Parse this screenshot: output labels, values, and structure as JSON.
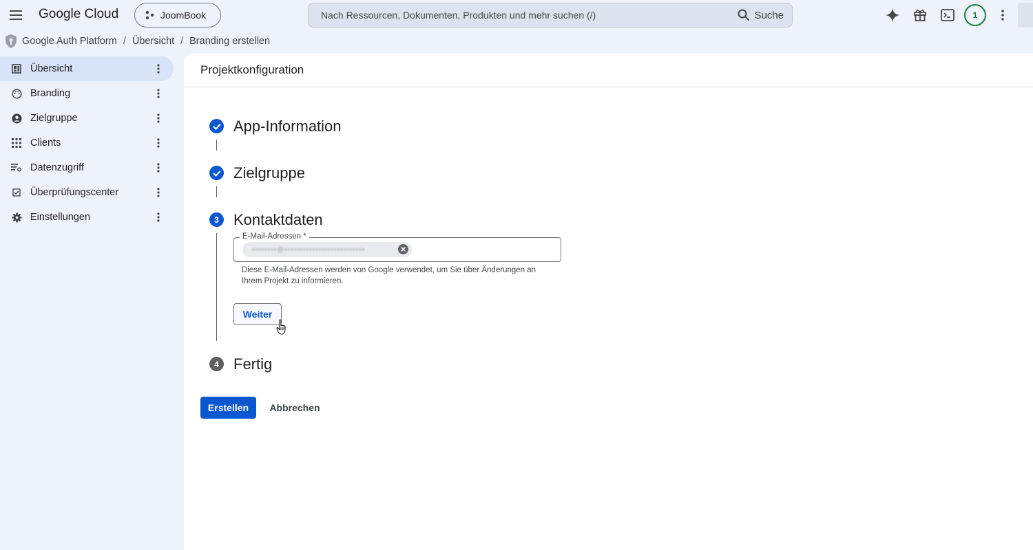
{
  "header": {
    "logo": "Google Cloud",
    "project": "JoomBook",
    "search_placeholder": "Nach Ressourcen, Dokumenten, Produkten und mehr suchen (/)",
    "search_button": "Suche",
    "notification_count": "1"
  },
  "breadcrumb": [
    "Google Auth Platform",
    "Übersicht",
    "Branding erstellen"
  ],
  "sidebar": {
    "items": [
      {
        "label": "Übersicht",
        "icon": "dashboard-icon",
        "active": true
      },
      {
        "label": "Branding",
        "icon": "palette-icon"
      },
      {
        "label": "Zielgruppe",
        "icon": "account-circle-icon"
      },
      {
        "label": "Clients",
        "icon": "apps-grid-icon"
      },
      {
        "label": "Datenzugriff",
        "icon": "data-filter-icon"
      },
      {
        "label": "Überprüfungscenter",
        "icon": "verify-checkbox-icon"
      },
      {
        "label": "Einstellungen",
        "icon": "gear-icon"
      }
    ]
  },
  "main": {
    "title": "Projektkonfiguration",
    "steps": [
      {
        "number": "1",
        "label": "App-Information",
        "state": "done"
      },
      {
        "number": "2",
        "label": "Zielgruppe",
        "state": "done"
      },
      {
        "number": "3",
        "label": "Kontaktdaten",
        "state": "current"
      },
      {
        "number": "4",
        "label": "Fertig",
        "state": "pending"
      }
    ],
    "email_field": {
      "label": "E-Mail-Adressen *",
      "chip_value": "••••••••@••••••••••••••••••••••••••",
      "helper": "Diese E-Mail-Adressen werden von Google verwendet, um Sie über Änderungen an Ihrem Projekt zu informieren."
    },
    "continue_button": "Weiter",
    "create_button": "Erstellen",
    "cancel_button": "Abbrechen"
  },
  "colors": {
    "accent": "#0b57d0",
    "badge": "#188038",
    "sidebar_bg": "#eef2fa",
    "active_item": "#d9e3f7"
  }
}
